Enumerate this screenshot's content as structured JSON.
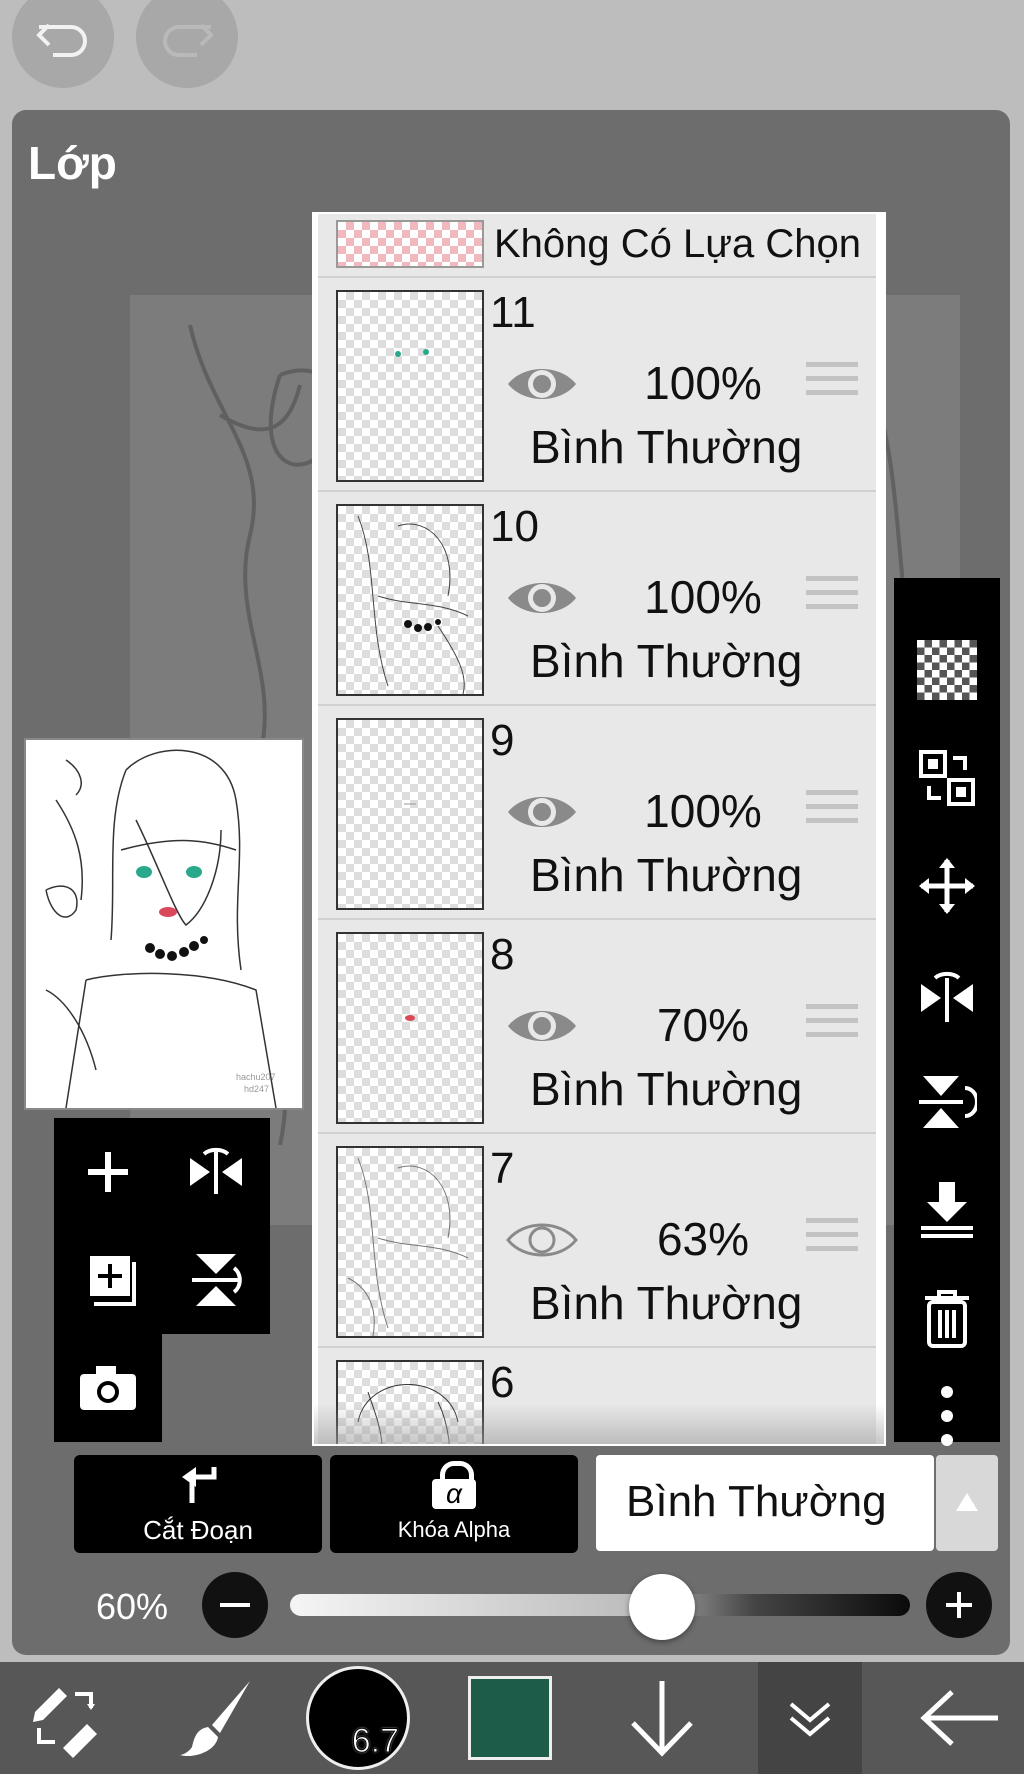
{
  "panel": {
    "title": "Lớp"
  },
  "top_bar": {
    "undo_icon": "undo-icon",
    "redo_icon": "redo-icon"
  },
  "selection_row": {
    "label": "Không Có Lựa Chọn"
  },
  "layers": [
    {
      "number": "11",
      "opacity": "100%",
      "mode": "Bình Thường",
      "visible": true
    },
    {
      "number": "10",
      "opacity": "100%",
      "mode": "Bình Thường",
      "visible": true
    },
    {
      "number": "9",
      "opacity": "100%",
      "mode": "Bình Thường",
      "visible": true
    },
    {
      "number": "8",
      "opacity": "70%",
      "mode": "Bình Thường",
      "visible": true
    },
    {
      "number": "7",
      "opacity": "63%",
      "mode": "Bình Thường",
      "visible": false
    },
    {
      "number": "6",
      "opacity": "",
      "mode": "",
      "visible": true
    }
  ],
  "buttons": {
    "clipping": "Cắt Đoạn",
    "alpha_lock": "Khóa Alpha",
    "alpha_glyph": "α"
  },
  "blend_mode": {
    "selected": "Bình Thường"
  },
  "opacity": {
    "label": "60%",
    "value": 0.6
  },
  "brush_size": {
    "label": "6.7"
  },
  "colors": {
    "current": "#1e5c4a",
    "accent": "#000000"
  },
  "thumbnail": {
    "signature_line1": "hachu207",
    "signature_line2": "hd247"
  }
}
